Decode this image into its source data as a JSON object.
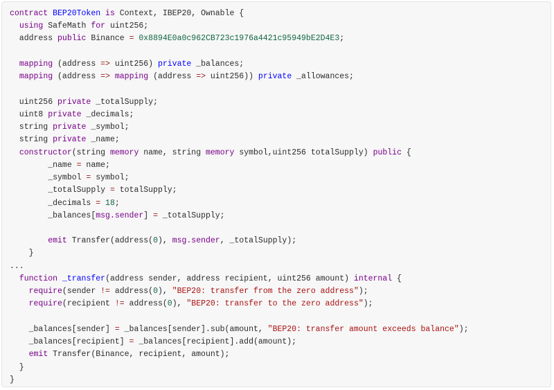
{
  "colors": {
    "keyword": "#770088",
    "definition": "#0000ff",
    "number": "#116644",
    "string": "#aa1111",
    "operator": "#981a1a",
    "plain": "#2b2b2b",
    "background": "#f7f7f7"
  },
  "code_lines": [
    [
      [
        "k",
        "contract"
      ],
      [
        "p",
        " "
      ],
      [
        "d",
        "BEP20Token"
      ],
      [
        "p",
        " "
      ],
      [
        "k",
        "is"
      ],
      [
        "p",
        " Context, IBEP20, Ownable {"
      ]
    ],
    [
      [
        "p",
        "  "
      ],
      [
        "k",
        "using"
      ],
      [
        "p",
        " SafeMath "
      ],
      [
        "k",
        "for"
      ],
      [
        "p",
        " uint256;"
      ]
    ],
    [
      [
        "p",
        "  address "
      ],
      [
        "k",
        "public"
      ],
      [
        "p",
        " Binance "
      ],
      [
        "o",
        "="
      ],
      [
        "p",
        " "
      ],
      [
        "n",
        "0x8894E0a0c962CB723c1976a4421c95949bE2D4E3"
      ],
      [
        "p",
        ";"
      ]
    ],
    [],
    [
      [
        "p",
        "  "
      ],
      [
        "k",
        "mapping"
      ],
      [
        "p",
        " (address "
      ],
      [
        "o",
        "=>"
      ],
      [
        "p",
        " uint256) "
      ],
      [
        "d",
        "private"
      ],
      [
        "p",
        " _balances;"
      ]
    ],
    [
      [
        "p",
        "  "
      ],
      [
        "k",
        "mapping"
      ],
      [
        "p",
        " (address "
      ],
      [
        "o",
        "=>"
      ],
      [
        "p",
        " "
      ],
      [
        "k",
        "mapping"
      ],
      [
        "p",
        " (address "
      ],
      [
        "o",
        "=>"
      ],
      [
        "p",
        " uint256)) "
      ],
      [
        "d",
        "private"
      ],
      [
        "p",
        " _allowances;"
      ]
    ],
    [],
    [
      [
        "p",
        "  uint256 "
      ],
      [
        "k",
        "private"
      ],
      [
        "p",
        " _totalSupply;"
      ]
    ],
    [
      [
        "p",
        "  uint8 "
      ],
      [
        "k",
        "private"
      ],
      [
        "p",
        " _decimals;"
      ]
    ],
    [
      [
        "p",
        "  string "
      ],
      [
        "k",
        "private"
      ],
      [
        "p",
        " _symbol;"
      ]
    ],
    [
      [
        "p",
        "  string "
      ],
      [
        "k",
        "private"
      ],
      [
        "p",
        " _name;"
      ]
    ],
    [
      [
        "p",
        "  "
      ],
      [
        "k",
        "constructor"
      ],
      [
        "p",
        "(string "
      ],
      [
        "k",
        "memory"
      ],
      [
        "p",
        " name, string "
      ],
      [
        "k",
        "memory"
      ],
      [
        "p",
        " symbol,uint256 totalSupply) "
      ],
      [
        "k",
        "public"
      ],
      [
        "p",
        " {"
      ]
    ],
    [
      [
        "p",
        "        _name "
      ],
      [
        "o",
        "="
      ],
      [
        "p",
        " name;"
      ]
    ],
    [
      [
        "p",
        "        _symbol "
      ],
      [
        "o",
        "="
      ],
      [
        "p",
        " symbol;"
      ]
    ],
    [
      [
        "p",
        "        _totalSupply "
      ],
      [
        "o",
        "="
      ],
      [
        "p",
        " totalSupply;"
      ]
    ],
    [
      [
        "p",
        "        _decimals "
      ],
      [
        "o",
        "="
      ],
      [
        "p",
        " "
      ],
      [
        "n",
        "18"
      ],
      [
        "p",
        ";"
      ]
    ],
    [
      [
        "p",
        "        _balances["
      ],
      [
        "k",
        "msg.sender"
      ],
      [
        "p",
        "] "
      ],
      [
        "o",
        "="
      ],
      [
        "p",
        " _totalSupply;"
      ]
    ],
    [],
    [
      [
        "p",
        "        "
      ],
      [
        "k",
        "emit"
      ],
      [
        "p",
        " Transfer(address("
      ],
      [
        "n",
        "0"
      ],
      [
        "p",
        "), "
      ],
      [
        "k",
        "msg.sender"
      ],
      [
        "p",
        ", _totalSupply);"
      ]
    ],
    [
      [
        "p",
        "    }"
      ]
    ],
    [
      [
        "p",
        "..."
      ]
    ],
    [
      [
        "p",
        "  "
      ],
      [
        "k",
        "function"
      ],
      [
        "p",
        " "
      ],
      [
        "d",
        "_transfer"
      ],
      [
        "p",
        "(address sender, address recipient, uint256 amount) "
      ],
      [
        "k",
        "internal"
      ],
      [
        "p",
        " {"
      ]
    ],
    [
      [
        "p",
        "    "
      ],
      [
        "k",
        "require"
      ],
      [
        "p",
        "(sender "
      ],
      [
        "o",
        "!="
      ],
      [
        "p",
        " address("
      ],
      [
        "n",
        "0"
      ],
      [
        "p",
        "), "
      ],
      [
        "s",
        "\"BEP20: transfer from the zero address\""
      ],
      [
        "p",
        ");"
      ]
    ],
    [
      [
        "p",
        "    "
      ],
      [
        "k",
        "require"
      ],
      [
        "p",
        "(recipient "
      ],
      [
        "o",
        "!="
      ],
      [
        "p",
        " address("
      ],
      [
        "n",
        "0"
      ],
      [
        "p",
        "), "
      ],
      [
        "s",
        "\"BEP20: transfer to the zero address\""
      ],
      [
        "p",
        ");"
      ]
    ],
    [],
    [
      [
        "p",
        "    _balances[sender] "
      ],
      [
        "o",
        "="
      ],
      [
        "p",
        " _balances[sender].sub(amount, "
      ],
      [
        "s",
        "\"BEP20: transfer amount exceeds balance\""
      ],
      [
        "p",
        ");"
      ]
    ],
    [
      [
        "p",
        "    _balances[recipient] "
      ],
      [
        "o",
        "="
      ],
      [
        "p",
        " _balances[recipient].add(amount);"
      ]
    ],
    [
      [
        "p",
        "    "
      ],
      [
        "k",
        "emit"
      ],
      [
        "p",
        " Transfer(Binance, recipient, amount);"
      ]
    ],
    [
      [
        "p",
        "  }"
      ]
    ],
    [
      [
        "p",
        "}"
      ]
    ]
  ]
}
